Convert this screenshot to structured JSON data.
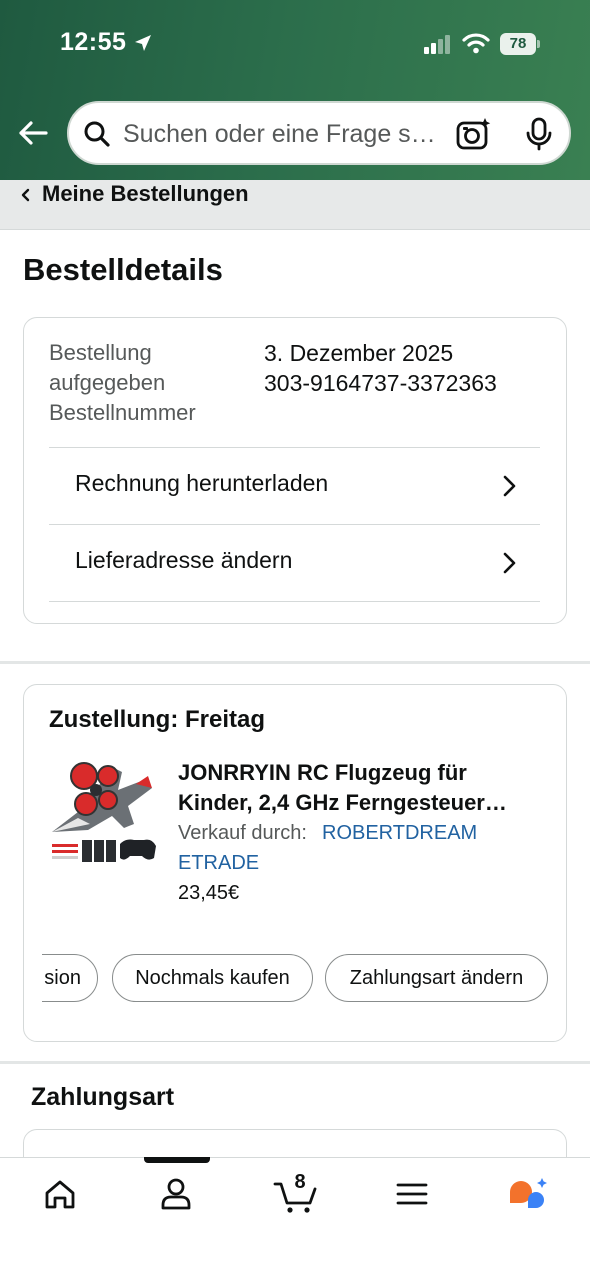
{
  "status_bar": {
    "time": "12:55",
    "battery": "78"
  },
  "search": {
    "placeholder": "Suchen oder eine Frage s…"
  },
  "breadcrumb": {
    "label": "Meine Bestellungen"
  },
  "page": {
    "title": "Bestelldetails"
  },
  "order_info": {
    "label_line1": "Bestellung",
    "label_line2": "aufgegeben",
    "label_line3": "Bestellnummer",
    "date": "3. Dezember 2025",
    "order_number": "303-9164737-3372363",
    "rows": [
      {
        "label": "Rechnung herunterladen"
      },
      {
        "label": "Lieferadresse ändern"
      }
    ]
  },
  "delivery": {
    "title": "Zustellung: Freitag",
    "product": {
      "title_line1": "JONRRYIN RC Flugzeug für",
      "title_line2": "Kinder, 2,4 GHz Ferngesteuer…",
      "seller_prefix": "Verkauf durch:",
      "seller_line1": "ROBERTDREAM",
      "seller_line2": "ETRADE",
      "price": "23,45€"
    },
    "actions": [
      {
        "label": "sion"
      },
      {
        "label": "Nochmals kaufen"
      },
      {
        "label": "Zahlungsart ändern"
      }
    ]
  },
  "payment": {
    "title": "Zahlungsart"
  },
  "bottom_nav": {
    "items": [
      {
        "icon": "home-icon"
      },
      {
        "icon": "account-icon"
      },
      {
        "icon": "cart-icon"
      },
      {
        "icon": "menu-icon"
      },
      {
        "icon": "rufus-assistant-icon"
      }
    ],
    "cart_count": "8"
  },
  "colors": {
    "header_gradient_start": "#1f5a40",
    "header_gradient_end": "#3a8052",
    "link": "#2162a1",
    "assistant_orange": "#f3722c",
    "assistant_blue": "#3b82f6"
  }
}
